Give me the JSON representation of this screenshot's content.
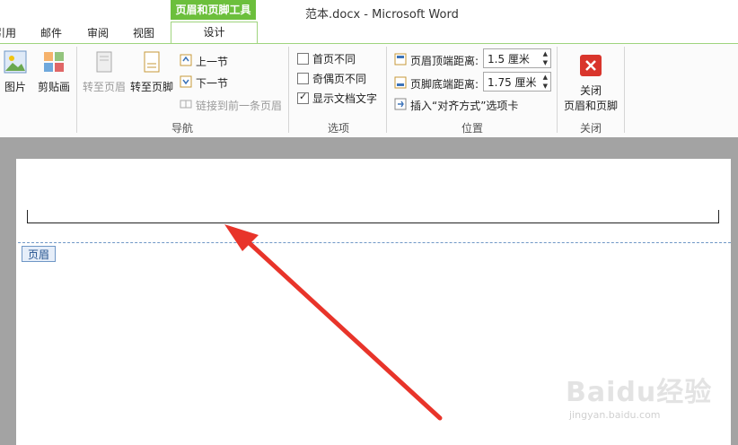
{
  "window": {
    "title": "范本.docx - Microsoft Word"
  },
  "context_group": "页眉和页脚工具",
  "tabs": [
    {
      "label": "引用"
    },
    {
      "label": "邮件"
    },
    {
      "label": "审阅"
    },
    {
      "label": "视图"
    },
    {
      "label": "设计",
      "active": true
    }
  ],
  "insert_group": {
    "picture": "图片",
    "clipart": "剪贴画"
  },
  "nav_group": {
    "label": "导航",
    "goto_header": "转至页眉",
    "goto_footer": "转至页脚",
    "prev_section": "上一节",
    "next_section": "下一节",
    "link_previous": "链接到前一条页眉"
  },
  "options_group": {
    "label": "选项",
    "different_first": "首页不同",
    "different_odd_even": "奇偶页不同",
    "show_text": "显示文档文字"
  },
  "position_group": {
    "label": "位置",
    "header_top_label": "页眉顶端距离:",
    "header_top_value": "1.5 厘米",
    "footer_bottom_label": "页脚底端距离:",
    "footer_bottom_value": "1.75 厘米",
    "insert_align_tab": "插入“对齐方式”选项卡"
  },
  "close_group": {
    "label": "关闭",
    "close_line1": "关闭",
    "close_line2": "页眉和页脚"
  },
  "document": {
    "header_badge": "页眉"
  },
  "watermark": {
    "brand": "Baidu经验",
    "url": "jingyan.baidu.com"
  }
}
